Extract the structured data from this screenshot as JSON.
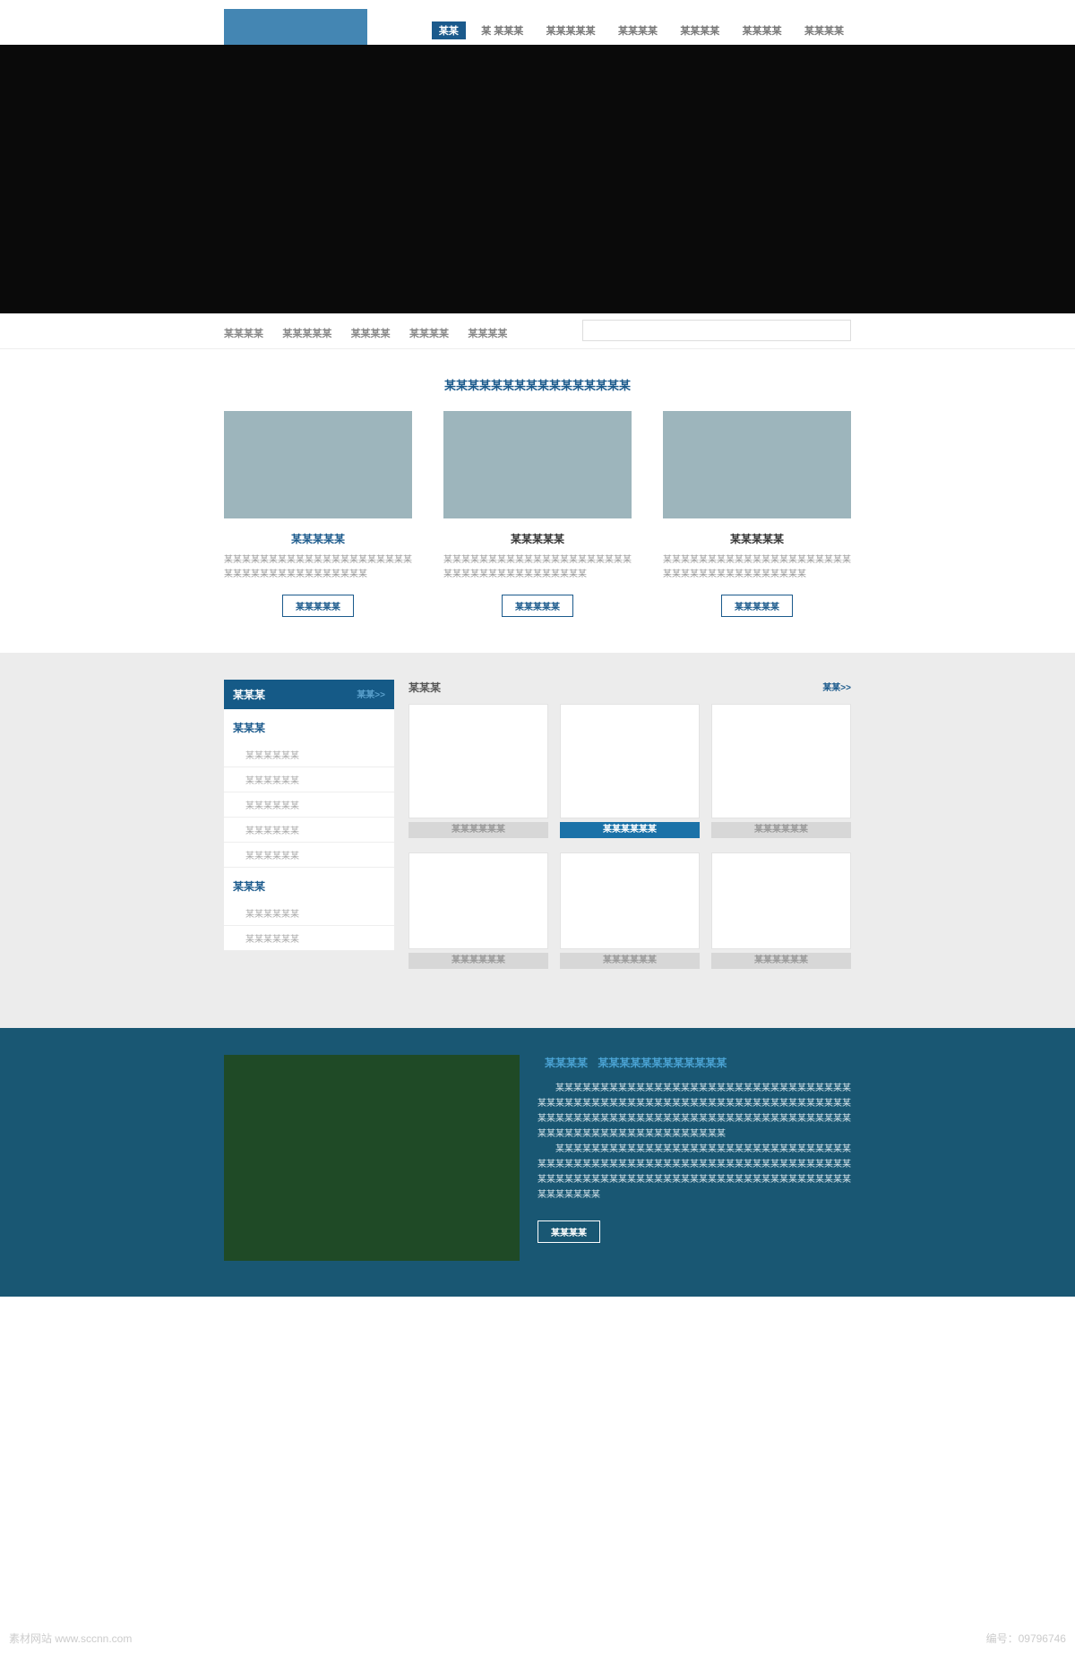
{
  "nav": {
    "active": "某某",
    "items": [
      "某某",
      "某 某某某",
      "某某某某某",
      "某某某某",
      "某某某某",
      "某某某某",
      "某某某某"
    ]
  },
  "subnav": {
    "items": [
      "某某某某",
      "某某某某某",
      "某某某某",
      "某某某某",
      "某某某某"
    ]
  },
  "intro": {
    "hl": "某某某某",
    "rest": "某某某某某某某某某某某某"
  },
  "cards": [
    {
      "title": "某某某某某",
      "hl": true,
      "desc": "某某某某某某某某某某某某某某某某某某某某某某某某某某某某某某某某某某某某某",
      "btn": "某某某某某"
    },
    {
      "title": "某某某某某",
      "hl": false,
      "desc": "某某某某某某某某某某某某某某某某某某某某某某某某某某某某某某某某某某某某某",
      "btn": "某某某某某"
    },
    {
      "title": "某某某某某",
      "hl": false,
      "desc": "某某某某某某某某某某某某某某某某某某某某某某某某某某某某某某某某某某某某某",
      "btn": "某某某某某"
    }
  ],
  "side": {
    "head": "某某某",
    "headMore": "某某>>",
    "cat1": "某某某",
    "items1": [
      "某某某某某某",
      "某某某某某某",
      "某某某某某某",
      "某某某某某某",
      "某某某某某某"
    ],
    "cat2": "某某某",
    "items2": [
      "某某某某某某",
      "某某某某某某"
    ]
  },
  "panel": {
    "head": "某某某",
    "more": "某某>>",
    "row1": [
      {
        "l": "某某某某某某",
        "a": false
      },
      {
        "l": "某某某某某某",
        "a": true
      },
      {
        "l": "某某某某某某",
        "a": false
      }
    ],
    "row2": [
      {
        "l": "某某某某某某",
        "a": false
      },
      {
        "l": "某某某某某某",
        "a": false
      },
      {
        "l": "某某某某某某",
        "a": false
      }
    ]
  },
  "blue": {
    "title": "某某某某",
    "sub": "某某某某某某某某某某某某",
    "p1": "某某某某某某某某某某某某某某某某某某某某某某某某某某某某某某某某某某某某某某某某某某某某某某某某某某某某某某某某某某某某某某某某某某某某某某某某某某某某某某某某某某某某某某某某某某某某某某某某某某某某某某某某某某某某某某某某某某某某某某某某某某某某",
    "p2": "某某某某某某某某某某某某某某某某某某某某某某某某某某某某某某某某某某某某某某某某某某某某某某某某某某某某某某某某某某某某某某某某某某某某某某某某某某某某某某某某某某某某某某某某某某某某某某某某某某某某某某某某某某某某某某",
    "btn": "某某某某"
  },
  "wm": {
    "left": "素材网站 www.sccnn.com",
    "right": "编号：09796746"
  }
}
